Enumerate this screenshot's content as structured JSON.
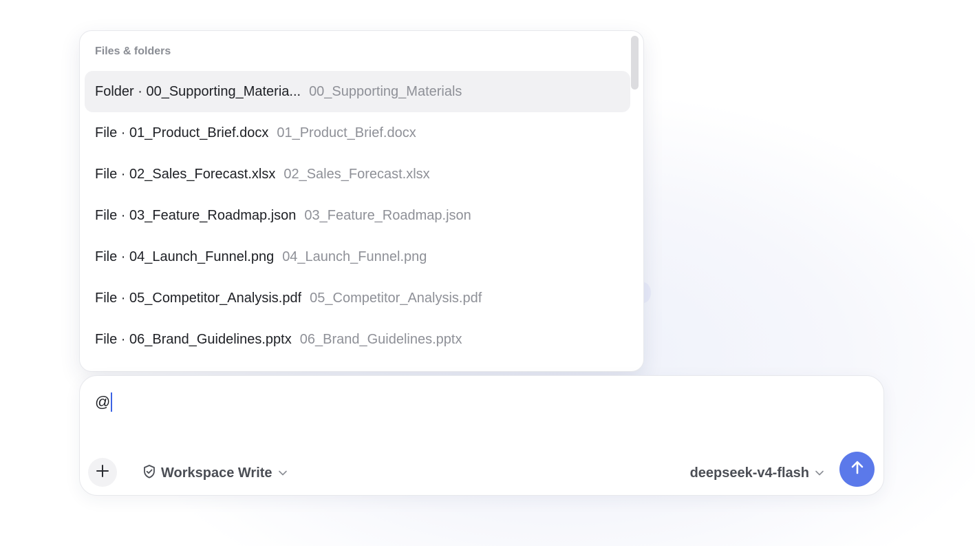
{
  "mention_popup": {
    "heading": "Files & folders",
    "items": [
      {
        "label": "Folder · 00_Supporting_Materia...",
        "path": "00_Supporting_Materials",
        "selected": true
      },
      {
        "label": "File · 01_Product_Brief.docx",
        "path": "01_Product_Brief.docx",
        "selected": false
      },
      {
        "label": "File · 02_Sales_Forecast.xlsx",
        "path": "02_Sales_Forecast.xlsx",
        "selected": false
      },
      {
        "label": "File · 03_Feature_Roadmap.json",
        "path": "03_Feature_Roadmap.json",
        "selected": false
      },
      {
        "label": "File · 04_Launch_Funnel.png",
        "path": "04_Launch_Funnel.png",
        "selected": false
      },
      {
        "label": "File · 05_Competitor_Analysis.pdf",
        "path": "05_Competitor_Analysis.pdf",
        "selected": false
      },
      {
        "label": "File · 06_Brand_Guidelines.pptx",
        "path": "06_Brand_Guidelines.pptx",
        "selected": false
      }
    ]
  },
  "composer": {
    "input_value": "@",
    "add_icon": "plus-icon",
    "permission": {
      "icon": "shield-check-icon",
      "label": "Workspace Write"
    },
    "model": {
      "label": "deepseek-v4-flash"
    },
    "send_icon": "arrow-up-icon"
  },
  "colors": {
    "accent": "#5b79ea",
    "selected_row": "#f1f1f3",
    "primary_text": "#1d1f24",
    "secondary_text": "#8e9097"
  }
}
